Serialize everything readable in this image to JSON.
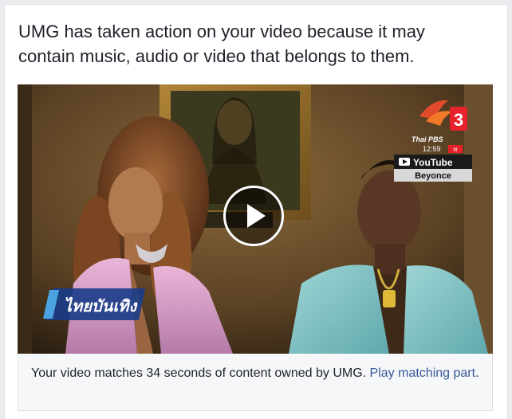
{
  "notice": {
    "line1": "UMG has taken action on your video because it may",
    "line2": "contain music, audio or video that belongs to them."
  },
  "video": {
    "watermark": {
      "channel": "Thai PBS",
      "channel_number": "3",
      "clock": "12:59",
      "rating": "ท",
      "source": "YouTube",
      "credit": "Beyonce"
    },
    "bug_logo": "ไทยบันเทิง",
    "play_icon": "play-icon"
  },
  "caption": {
    "text": "Your video matches 34 seconds of content owned by UMG. ",
    "link": "Play matching part",
    "end": "."
  },
  "colors": {
    "text": "#1d2129",
    "link": "#365899",
    "caption_bg": "#f6f7f9",
    "border": "#dddfe2",
    "page_bg": "#e9ebee"
  }
}
